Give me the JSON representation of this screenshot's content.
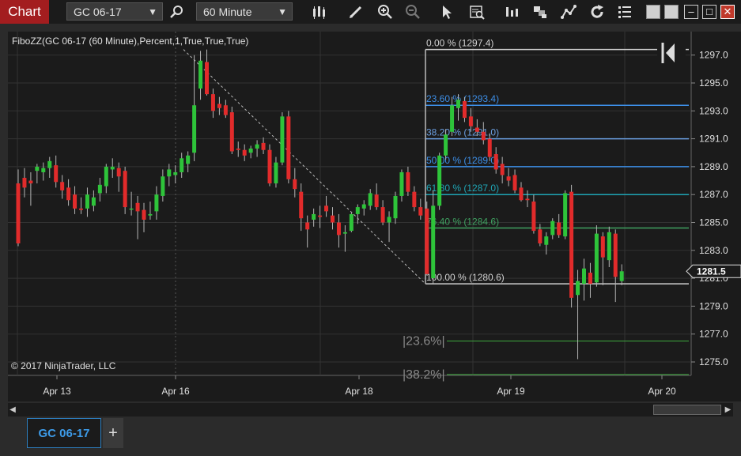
{
  "toolbar": {
    "chart_tab": "Chart",
    "instrument": "GC 06-17",
    "interval": "60 Minute",
    "icons": [
      "bar-type-icon",
      "pencil-icon",
      "zoom-in-icon",
      "zoom-out-icon",
      "pointer-icon",
      "data-box-icon",
      "indicators-icon",
      "strategies-icon",
      "drawing-tools-icon",
      "reload-icon",
      "properties-icon"
    ],
    "window_controls": [
      "tile-icon",
      "restore-icon",
      "minimize-icon",
      "maximize-icon",
      "close-icon"
    ]
  },
  "chart_data": {
    "type": "candlestick",
    "title": "FiboZZ(GC 06-17 (60 Minute),Percent,1,True,True,True)",
    "copyright": "© 2017 NinjaTrader, LLC",
    "ylim": [
      1274.2,
      1298.9
    ],
    "y_ticks": [
      "1297.0",
      "1295.0",
      "1293.0",
      "1291.0",
      "1289.0",
      "1287.0",
      "1285.0",
      "1283.0",
      "1281.0",
      "1279.0",
      "1277.0",
      "1275.0"
    ],
    "x_ticks": [
      "Apr 13",
      "Apr 16",
      "Apr 18",
      "Apr 19",
      "Apr 20"
    ],
    "current_price": "1281.5",
    "fib_levels": [
      {
        "label": "0.00 % (1297.4)",
        "price": 1297.4,
        "color": "#d0d0d0"
      },
      {
        "label": "23.60 % (1293.4)",
        "price": 1293.4,
        "color": "#3d8fe8"
      },
      {
        "label": "38.20 % (1291.0)",
        "price": 1291.0,
        "color": "#6a9ee0"
      },
      {
        "label": "50.00 % (1289.0)",
        "price": 1289.0,
        "color": "#3d8fe8"
      },
      {
        "label": "61.80 % (1287.0)",
        "price": 1287.0,
        "color": "#1fa5b5"
      },
      {
        "label": "76.40 % (1284.6)",
        "price": 1284.6,
        "color": "#3fa060"
      },
      {
        "label": "100.00 % (1280.6)",
        "price": 1280.6,
        "color": "#d0d0d0"
      }
    ],
    "ext_levels": [
      {
        "label": "|23.6%|",
        "price": 1276.5,
        "color": "#3ea83e"
      },
      {
        "label": "|38.2%|",
        "price": 1274.1,
        "color": "#3ea83e"
      }
    ],
    "zigzag": [
      [
        1297.4,
        1280.6
      ]
    ],
    "candles": [
      [
        1287.8,
        1288.8,
        1283.3,
        1283.5
      ],
      [
        1288.2,
        1288.9,
        1286.8,
        1287.5
      ],
      [
        1288.0,
        1288.6,
        1286.2,
        1287.8
      ],
      [
        1288.7,
        1289.2,
        1287.8,
        1289.0
      ],
      [
        1288.6,
        1289.3,
        1288.0,
        1288.9
      ],
      [
        1288.9,
        1289.7,
        1288.2,
        1289.4
      ],
      [
        1289.1,
        1289.8,
        1287.5,
        1287.9
      ],
      [
        1287.9,
        1288.4,
        1286.7,
        1287.3
      ],
      [
        1287.5,
        1288.1,
        1286.2,
        1286.6
      ],
      [
        1287.0,
        1287.6,
        1285.6,
        1286.0
      ],
      [
        1286.0,
        1286.8,
        1285.6,
        1285.9
      ],
      [
        1286.0,
        1287.5,
        1285.4,
        1287.0
      ],
      [
        1286.2,
        1287.3,
        1285.8,
        1286.8
      ],
      [
        1287.1,
        1288.2,
        1286.5,
        1287.7
      ],
      [
        1287.6,
        1289.2,
        1287.1,
        1289.0
      ],
      [
        1288.8,
        1289.6,
        1288.2,
        1289.0
      ],
      [
        1288.9,
        1289.3,
        1287.2,
        1288.3
      ],
      [
        1288.7,
        1289.0,
        1285.6,
        1286.1
      ],
      [
        1286.0,
        1287.2,
        1285.5,
        1286.0
      ],
      [
        1286.4,
        1286.9,
        1283.8,
        1285.8
      ],
      [
        1285.9,
        1286.4,
        1284.3,
        1285.2
      ],
      [
        1285.5,
        1286.5,
        1285.2,
        1285.6
      ],
      [
        1285.8,
        1287.6,
        1285.2,
        1287.0
      ],
      [
        1286.9,
        1288.8,
        1286.5,
        1288.3
      ],
      [
        1288.3,
        1289.2,
        1287.6,
        1288.8
      ],
      [
        1288.4,
        1289.1,
        1287.8,
        1288.6
      ],
      [
        1288.6,
        1290.0,
        1288.2,
        1289.6
      ],
      [
        1289.2,
        1290.1,
        1288.6,
        1289.8
      ],
      [
        1290.0,
        1297.0,
        1289.4,
        1293.4
      ],
      [
        1294.6,
        1297.3,
        1293.8,
        1296.6
      ],
      [
        1296.5,
        1297.4,
        1294.1,
        1294.2
      ],
      [
        1294.2,
        1294.6,
        1292.5,
        1293.0
      ],
      [
        1293.5,
        1294.0,
        1292.7,
        1293.2
      ],
      [
        1293.4,
        1293.8,
        1292.5,
        1292.7
      ],
      [
        1292.9,
        1293.3,
        1289.9,
        1290.1
      ],
      [
        1290.3,
        1290.8,
        1289.7,
        1290.2
      ],
      [
        1290.2,
        1290.6,
        1289.4,
        1289.8
      ],
      [
        1290.0,
        1290.5,
        1289.6,
        1290.3
      ],
      [
        1290.3,
        1290.9,
        1289.7,
        1290.6
      ],
      [
        1290.7,
        1291.1,
        1289.9,
        1290.2
      ],
      [
        1290.2,
        1290.6,
        1287.6,
        1287.8
      ],
      [
        1287.8,
        1289.7,
        1287.5,
        1289.3
      ],
      [
        1289.3,
        1292.9,
        1289.1,
        1292.6
      ],
      [
        1292.6,
        1293.0,
        1287.8,
        1288.1
      ],
      [
        1288.1,
        1288.9,
        1286.8,
        1287.4
      ],
      [
        1287.2,
        1287.8,
        1284.4,
        1285.3
      ],
      [
        1285.0,
        1285.5,
        1283.2,
        1284.5
      ],
      [
        1285.2,
        1286.0,
        1284.7,
        1285.6
      ],
      [
        1285.5,
        1286.2,
        1284.6,
        1285.4
      ],
      [
        1286.2,
        1286.9,
        1285.4,
        1285.8
      ],
      [
        1285.5,
        1286.1,
        1284.5,
        1285.0
      ],
      [
        1285.0,
        1285.6,
        1283.2,
        1284.1
      ],
      [
        1284.2,
        1284.8,
        1282.9,
        1284.3
      ],
      [
        1284.4,
        1285.7,
        1284.3,
        1285.6
      ],
      [
        1285.6,
        1286.3,
        1284.9,
        1286.1
      ],
      [
        1286.0,
        1286.6,
        1285.5,
        1286.3
      ],
      [
        1286.2,
        1287.4,
        1285.9,
        1287.1
      ],
      [
        1287.0,
        1287.8,
        1285.9,
        1286.1
      ],
      [
        1286.1,
        1286.6,
        1284.8,
        1285.0
      ],
      [
        1285.0,
        1285.8,
        1283.6,
        1285.4
      ],
      [
        1285.3,
        1287.2,
        1284.9,
        1286.9
      ],
      [
        1286.9,
        1288.8,
        1286.5,
        1288.6
      ],
      [
        1288.6,
        1289.0,
        1286.9,
        1287.2
      ],
      [
        1287.2,
        1287.6,
        1285.8,
        1286.1
      ],
      [
        1286.1,
        1286.7,
        1285.2,
        1285.5
      ],
      [
        1286.0,
        1286.5,
        1281.2,
        1281.3
      ],
      [
        1281.0,
        1287.3,
        1280.6,
        1286.2
      ],
      [
        1286.2,
        1290.0,
        1285.9,
        1289.8
      ],
      [
        1289.8,
        1291.7,
        1289.5,
        1291.3
      ],
      [
        1291.5,
        1294.0,
        1291.2,
        1293.4
      ],
      [
        1293.2,
        1294.2,
        1292.3,
        1293.8
      ],
      [
        1293.7,
        1294.0,
        1292.2,
        1292.5
      ],
      [
        1292.6,
        1293.2,
        1291.5,
        1291.9
      ],
      [
        1291.8,
        1292.4,
        1291.2,
        1291.5
      ],
      [
        1291.5,
        1292.2,
        1290.6,
        1290.9
      ],
      [
        1291.0,
        1291.4,
        1289.4,
        1289.7
      ],
      [
        1289.9,
        1290.4,
        1288.5,
        1288.8
      ],
      [
        1289.2,
        1289.7,
        1287.8,
        1288.4
      ],
      [
        1288.3,
        1288.9,
        1287.6,
        1288.0
      ],
      [
        1288.4,
        1288.8,
        1287.1,
        1287.3
      ],
      [
        1287.5,
        1287.9,
        1286.5,
        1286.6
      ],
      [
        1286.7,
        1287.3,
        1286.1,
        1286.6
      ],
      [
        1286.5,
        1287.0,
        1284.2,
        1284.4
      ],
      [
        1284.5,
        1284.9,
        1283.3,
        1283.5
      ],
      [
        1283.4,
        1284.3,
        1282.7,
        1284.0
      ],
      [
        1284.1,
        1285.3,
        1283.8,
        1285.1
      ],
      [
        1285.0,
        1285.6,
        1283.9,
        1284.1
      ],
      [
        1284.0,
        1287.3,
        1283.8,
        1287.1
      ],
      [
        1287.2,
        1287.7,
        1278.9,
        1279.6
      ],
      [
        1279.8,
        1281.6,
        1275.2,
        1280.8
      ],
      [
        1280.6,
        1282.4,
        1279.4,
        1281.7
      ],
      [
        1281.4,
        1282.1,
        1279.6,
        1280.6
      ],
      [
        1280.7,
        1284.8,
        1280.4,
        1284.2
      ],
      [
        1284.0,
        1284.3,
        1280.5,
        1282.5
      ],
      [
        1282.3,
        1284.7,
        1281.8,
        1284.3
      ],
      [
        1284.2,
        1284.5,
        1279.3,
        1281.1
      ],
      [
        1280.8,
        1282.0,
        1280.5,
        1281.5
      ]
    ]
  }
}
